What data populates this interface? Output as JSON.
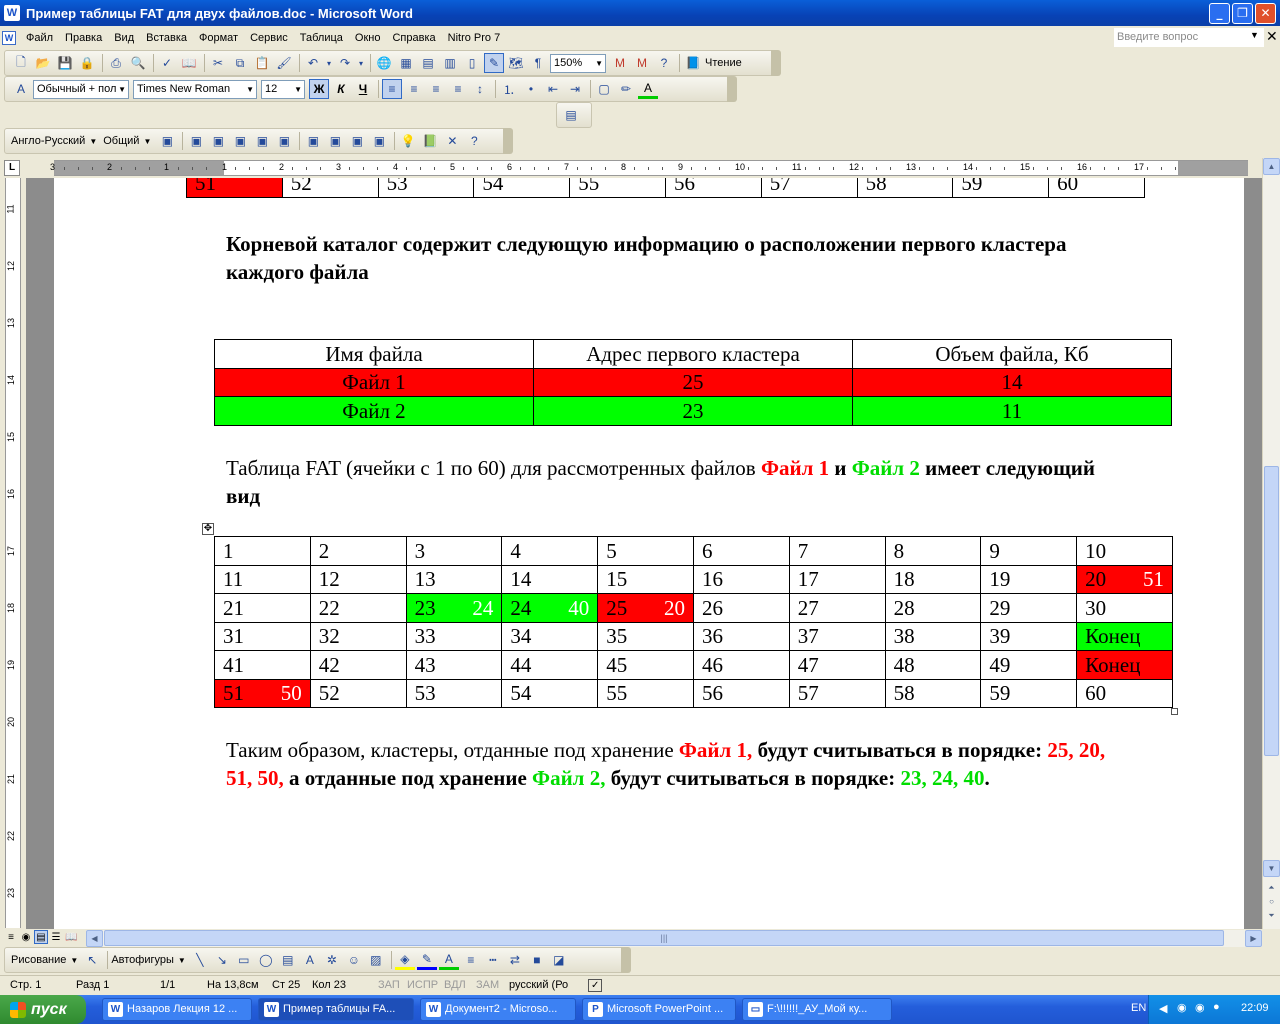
{
  "window": {
    "title": "Пример таблицы FAT для двух файлов.doc - Microsoft Word"
  },
  "menu": {
    "items": [
      "Файл",
      "Правка",
      "Вид",
      "Вставка",
      "Формат",
      "Сервис",
      "Таблица",
      "Окно",
      "Справка",
      "Nitro Pro 7"
    ],
    "help_placeholder": "Введите вопрос"
  },
  "toolbar_standard": {
    "zoom": "150%",
    "reading_label": "Чтение"
  },
  "toolbar_format": {
    "style": "Обычный + пол",
    "font": "Times New Roman",
    "size": "12",
    "bold": "Ж",
    "italic": "К",
    "underline": "Ч"
  },
  "toolbar_translate": {
    "lang": "Англо-Русский",
    "common": "Общий"
  },
  "ruler": {
    "h_labels": [
      "3",
      "2",
      "1",
      "1",
      "2",
      "3",
      "4",
      "5",
      "6",
      "7",
      "8",
      "9",
      "10",
      "11",
      "12",
      "13",
      "14",
      "15",
      "16",
      "17"
    ],
    "v_labels": [
      "11",
      "12",
      "13",
      "14",
      "15",
      "16",
      "17",
      "18",
      "19",
      "20",
      "21",
      "22",
      "23"
    ]
  },
  "doc": {
    "top_row": [
      "51",
      "52",
      "53",
      "54",
      "55",
      "56",
      "57",
      "58",
      "59",
      "60"
    ],
    "heading": "Корневой каталог содержит следующую информацию о расположении первого кластера каждого файла",
    "info_table": {
      "headers": [
        "Имя файла",
        "Адрес первого кластера",
        "Объем файла, Кб"
      ],
      "rows": [
        {
          "color": "red",
          "cells": [
            "Файл  1",
            "25",
            "14"
          ]
        },
        {
          "color": "green",
          "cells": [
            "Файл 2",
            "23",
            "11"
          ]
        }
      ]
    },
    "para2": {
      "text": "Таблица FAT (ячейки с 1 по 60)  для рассмотренных файлов ",
      "file1": "Файл 1",
      "and": " и  ",
      "file2": "Файл 2",
      "rest": "   имеет следующий вид"
    },
    "fat_table": [
      [
        {
          "v": "1"
        },
        {
          "v": "2"
        },
        {
          "v": "3"
        },
        {
          "v": "4"
        },
        {
          "v": "5"
        },
        {
          "v": "6"
        },
        {
          "v": "7"
        },
        {
          "v": "8"
        },
        {
          "v": "9"
        },
        {
          "v": "10"
        }
      ],
      [
        {
          "v": "11"
        },
        {
          "v": "12"
        },
        {
          "v": "13"
        },
        {
          "v": "14"
        },
        {
          "v": "15"
        },
        {
          "v": "16"
        },
        {
          "v": "17"
        },
        {
          "v": "18"
        },
        {
          "v": "19"
        },
        {
          "v": "20",
          "n": "51",
          "c": "red"
        }
      ],
      [
        {
          "v": "21"
        },
        {
          "v": "22"
        },
        {
          "v": "23",
          "n": "24",
          "c": "green"
        },
        {
          "v": "24",
          "n": "40",
          "c": "green"
        },
        {
          "v": "25",
          "n": "20",
          "c": "red"
        },
        {
          "v": "26"
        },
        {
          "v": "27"
        },
        {
          "v": "28"
        },
        {
          "v": "29"
        },
        {
          "v": "30"
        }
      ],
      [
        {
          "v": "31"
        },
        {
          "v": "32"
        },
        {
          "v": "33"
        },
        {
          "v": "34"
        },
        {
          "v": "35"
        },
        {
          "v": "36"
        },
        {
          "v": "37"
        },
        {
          "v": "38"
        },
        {
          "v": "39"
        },
        {
          "v": "Конец",
          "c": "green"
        }
      ],
      [
        {
          "v": "41"
        },
        {
          "v": "42"
        },
        {
          "v": "43"
        },
        {
          "v": "44"
        },
        {
          "v": "45"
        },
        {
          "v": "46"
        },
        {
          "v": "47"
        },
        {
          "v": "48"
        },
        {
          "v": "49"
        },
        {
          "v": "Конец",
          "c": "red"
        }
      ],
      [
        {
          "v": "51",
          "n": "50",
          "c": "red"
        },
        {
          "v": "52"
        },
        {
          "v": "53"
        },
        {
          "v": "54"
        },
        {
          "v": "55"
        },
        {
          "v": "56"
        },
        {
          "v": "57"
        },
        {
          "v": "58"
        },
        {
          "v": "59"
        },
        {
          "v": "60"
        }
      ]
    ],
    "para3": {
      "t1": "Таким образом, кластеры, отданные под хранение ",
      "file1": "Файл 1,",
      "t2": " будут считываться в порядке: ",
      "seq1": "25, 20, 51, 50,",
      "t3": "   а отданные под хранение ",
      "file2": "Файл 2,",
      "t4": " будут считываться в порядке: ",
      "seq2": "23, 24, 40",
      "t5": "."
    }
  },
  "drawbar": {
    "drawing": "Рисование",
    "autoshapes": "Автофигуры"
  },
  "status": {
    "page": "Стр.  1",
    "section": "Разд  1",
    "pages": "1/1",
    "at": "На  13,8см",
    "line": "Ст  25",
    "col": "Кол  23",
    "rec": "ЗАП",
    "trk": "ИСПР",
    "ext": "ВДЛ",
    "ovr": "ЗАМ",
    "lang": "русский (Ро"
  },
  "taskbar": {
    "start": "пуск",
    "tasks": [
      "Назаров Лекция 12 ...",
      "Пример таблицы FA...",
      "Документ2 - Microso...",
      "Microsoft PowerPoint ...",
      "F:\\!!!!!!_АУ_Мой ку..."
    ],
    "lang": "EN",
    "clock": "22:09"
  },
  "colors": {
    "red": "#ff0000",
    "green": "#00ff00",
    "title_blue": "#0842b5"
  }
}
